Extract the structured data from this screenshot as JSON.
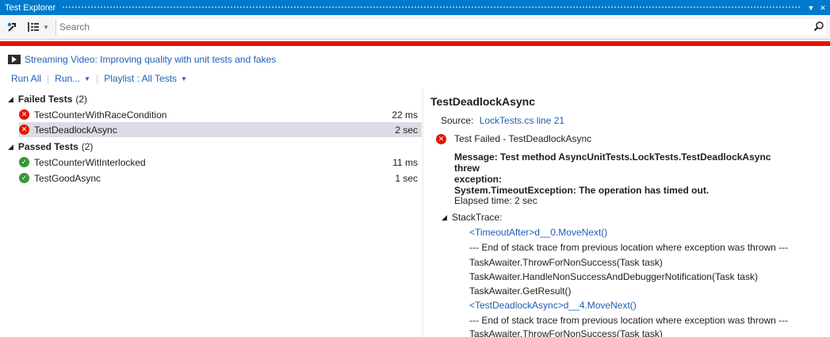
{
  "window": {
    "title": "Test Explorer",
    "pin_glyph": "▼",
    "close_glyph": "✕"
  },
  "toolbar": {
    "search_placeholder": "Search"
  },
  "banner": {
    "video_link": "Streaming Video: Improving quality with unit tests and fakes"
  },
  "actions": {
    "run_all": "Run All",
    "run": "Run...",
    "playlist": "Playlist : All Tests"
  },
  "groups": {
    "failed": {
      "label": "Failed Tests",
      "count": "(2)"
    },
    "passed": {
      "label": "Passed Tests",
      "count": "(2)"
    }
  },
  "failed_tests": [
    {
      "name": "TestCounterWithRaceCondition",
      "duration": "22 ms"
    },
    {
      "name": "TestDeadlockAsync",
      "duration": "2 sec"
    }
  ],
  "passed_tests": [
    {
      "name": "TestCounterWitInterlocked",
      "duration": "11 ms"
    },
    {
      "name": "TestGoodAsync",
      "duration": "1 sec"
    }
  ],
  "detail": {
    "title": "TestDeadlockAsync",
    "source_label": "Source:",
    "source_link": "LockTests.cs line 21",
    "status": "Test Failed - TestDeadlockAsync",
    "message_line1": "Message: Test method AsyncUnitTests.LockTests.TestDeadlockAsync threw",
    "message_line2": "exception:",
    "message_line3": "System.TimeoutException: The operation has timed out.",
    "elapsed": "Elapsed time: 2 sec",
    "stack_label": "StackTrace:",
    "stack": [
      {
        "text": "<TimeoutAfter>d__0.MoveNext()",
        "link": true
      },
      {
        "text": "--- End of stack trace from previous location where exception was thrown ---",
        "link": false
      },
      {
        "text": "TaskAwaiter.ThrowForNonSuccess(Task task)",
        "link": false
      },
      {
        "text": "TaskAwaiter.HandleNonSuccessAndDebuggerNotification(Task task)",
        "link": false
      },
      {
        "text": "TaskAwaiter.GetResult()",
        "link": false
      },
      {
        "text": "<TestDeadlockAsync>d__4.MoveNext()",
        "link": true
      },
      {
        "text": "--- End of stack trace from previous location where exception was thrown ---",
        "link": false
      },
      {
        "text": "TaskAwaiter.ThrowForNonSuccess(Task task)",
        "link": false
      }
    ]
  },
  "colors": {
    "accent": "#007acc",
    "failure_bar": "#e51400",
    "link": "#1e5fb5",
    "pass": "#339933",
    "selected_row": "#dcdce4"
  }
}
